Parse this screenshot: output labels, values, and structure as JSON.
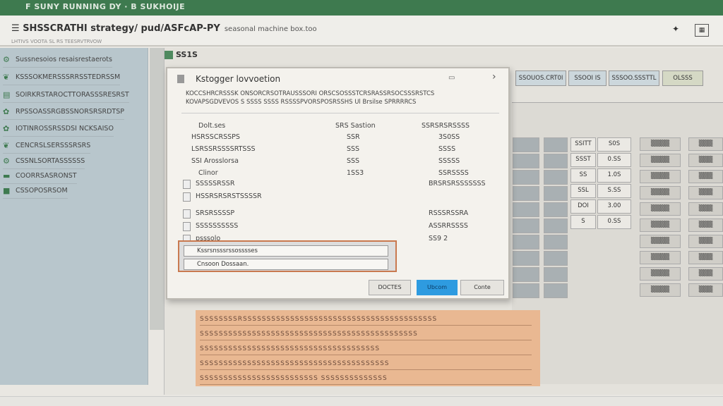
{
  "app": {
    "title_bar": "F SUNY RUNNING DY · B SUKHOIJE",
    "title": "SHSSCRATHI strategy/ pud/ASFcAP-PY",
    "title_tail": "seasonal machine box.too",
    "subtitle": "LHTIVS VOOTA SL RS TEESRVTRVOW"
  },
  "toolbar": {
    "pin_icon": "✦",
    "menu_icon": "☰"
  },
  "sidebar": {
    "items": [
      {
        "icon": "gear-icon",
        "label": "Sussnesoios resaisrestaerots"
      },
      {
        "icon": "leaf-icon",
        "label": "KSSSOKMERSSSRRSSTEDRSSM"
      },
      {
        "icon": "doc-icon",
        "label": "SOIRKRSTAROCTTORASSSRESRST"
      },
      {
        "icon": "plant-icon",
        "label": "RPSSOASSRGBSSNORSRSRDTSP"
      },
      {
        "icon": "plant-icon",
        "label": "IOTINROSSRSSDSI NCKSAISO"
      },
      {
        "icon": "leaf-icon",
        "label": "CENCRSLSERSSSRSRS"
      },
      {
        "icon": "gear-icon",
        "label": "CSSNLSORTASSSSSS"
      },
      {
        "icon": "folder-icon",
        "label": "COORRSASRONST"
      },
      {
        "icon": "box-icon",
        "label": "CSSOPOSRSOM"
      }
    ]
  },
  "main": {
    "header": "SS1S"
  },
  "dialog": {
    "title": "Kstogger lovvoetion",
    "description": "KOCCSHRCRSSSK ONSORCRSOTRAUSSSORI ORSCSOSSSTCRSRASSRSOCSSSRSTCS KOVAPSGDVEVOS S SSSS SSSS RSSSSPVORSPOSRSSHS Ul Brsilse SPRRRRCS",
    "headers": [
      "Dolt.ses",
      "SRS Sastion",
      "SSRSRSRSSSS"
    ],
    "rows": [
      {
        "label": "HSRSSCRSSPS",
        "value": "SSR",
        "value2": "3S0SS"
      },
      {
        "label": "LSRSSRSSSSRTSSS",
        "value": "SSS",
        "value2": "SSSS"
      },
      {
        "label": "SSI Arosslorsa",
        "value": "SSS",
        "value2": "SSSSS"
      },
      {
        "label": "Clinor",
        "value": "1SS3",
        "value2": "SSRSSSS"
      }
    ],
    "checks": [
      {
        "label": "SSSSSRSSR",
        "value": "BRSRSRSSSSSSS"
      },
      {
        "label": "HSSRSRSRSTSSSSR",
        "value": ""
      },
      {
        "label": "SRSRSSSSP",
        "value": "RSSSRSSRA"
      },
      {
        "label": "SSSSSSSSSS",
        "value": "ASSRRSSSS"
      },
      {
        "label": "psssolo",
        "value": "SS9 2"
      }
    ],
    "select_options": [
      "Kssrsnsssrssosssses",
      "Cnsoon Dossaan."
    ],
    "buttons": {
      "secondary": "DOCTES",
      "primary": "Ubcom",
      "cancel": "Conte"
    },
    "colors": {
      "primary": "#2e9be0",
      "highlight": "#c9794f"
    }
  },
  "grid": {
    "tabs": [
      "SSOUOS.CRT0I",
      "SSOOI IS",
      "SSSOO.SSSTTL",
      "OLSSS"
    ],
    "values": [
      "S0S",
      "0.SS",
      "1.0S",
      "S.SS",
      "3.00",
      "0.SS"
    ],
    "ids": [
      "SSITT",
      "SSST",
      "SS",
      "SSL",
      "DOI",
      "S"
    ]
  },
  "bottom": {
    "rows": [
      "SSSSSSSSRSSSSSSSSSSSSSSSSSSSSSSSSSSSSSSSSSSSSSSSSS",
      "SSSSSSSSSSSSSSSSSSSSSSSSSSSSSSSSSSSSSSSSSSSSSS",
      "SSSSSSSSSSSSSSSSSSSSSSSSSSSSSSSSSSSSSS",
      "SSSSSSSSSSSSSSSSSSSSSSSSSSSSSSSSSSSSSSSS",
      "SSSSSSSSSSSSSSSSSSSSSSSSS SSSSSSSSSSSSSS"
    ]
  }
}
